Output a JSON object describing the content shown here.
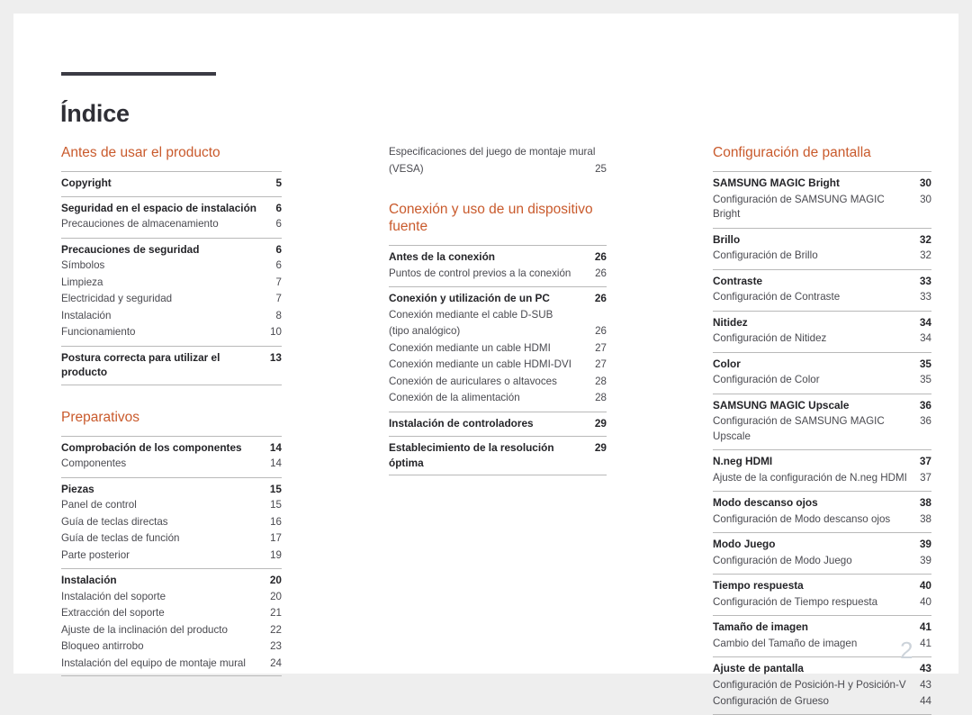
{
  "document": {
    "title": "Índice",
    "folio": "2",
    "accent_color": "#c95a2c",
    "rule_color": "#3b3b44",
    "text_color": "#3a3a40",
    "page_background": "#ffffff",
    "canvas_background": "#eeeeee"
  },
  "columns": [
    {
      "name": "column-left",
      "sections": [
        {
          "heading": "Antes de usar el producto",
          "groups": [
            {
              "entries": [
                {
                  "label": "Copyright",
                  "page": "5",
                  "level": "main"
                }
              ]
            },
            {
              "entries": [
                {
                  "label": "Seguridad en el espacio de instalación",
                  "page": "6",
                  "level": "main"
                },
                {
                  "label": "Precauciones de almacenamiento",
                  "page": "6",
                  "level": "sub"
                }
              ]
            },
            {
              "entries": [
                {
                  "label": "Precauciones de seguridad",
                  "page": "6",
                  "level": "main"
                },
                {
                  "label": "Símbolos",
                  "page": "6",
                  "level": "sub"
                },
                {
                  "label": "Limpieza",
                  "page": "7",
                  "level": "sub"
                },
                {
                  "label": "Electricidad y seguridad",
                  "page": "7",
                  "level": "sub"
                },
                {
                  "label": "Instalación",
                  "page": "8",
                  "level": "sub"
                },
                {
                  "label": "Funcionamiento",
                  "page": "10",
                  "level": "sub"
                }
              ]
            },
            {
              "entries": [
                {
                  "label": "Postura correcta para utilizar el producto",
                  "page": "13",
                  "level": "main"
                }
              ]
            }
          ]
        },
        {
          "heading": "Preparativos",
          "groups": [
            {
              "entries": [
                {
                  "label": "Comprobación de los componentes",
                  "page": "14",
                  "level": "main"
                },
                {
                  "label": "Componentes",
                  "page": "14",
                  "level": "sub"
                }
              ]
            },
            {
              "entries": [
                {
                  "label": "Piezas",
                  "page": "15",
                  "level": "main"
                },
                {
                  "label": "Panel de control",
                  "page": "15",
                  "level": "sub"
                },
                {
                  "label": "Guía de teclas directas",
                  "page": "16",
                  "level": "sub"
                },
                {
                  "label": "Guía de teclas de función",
                  "page": "17",
                  "level": "sub"
                },
                {
                  "label": "Parte posterior",
                  "page": "19",
                  "level": "sub"
                }
              ]
            },
            {
              "entries": [
                {
                  "label": "Instalación",
                  "page": "20",
                  "level": "main"
                },
                {
                  "label": "Instalación del soporte",
                  "page": "20",
                  "level": "sub"
                },
                {
                  "label": "Extracción del soporte",
                  "page": "21",
                  "level": "sub"
                },
                {
                  "label": "Ajuste de la inclinación del producto",
                  "page": "22",
                  "level": "sub"
                },
                {
                  "label": "Bloqueo antirrobo",
                  "page": "23",
                  "level": "sub"
                },
                {
                  "label": "Instalación del equipo de montaje mural",
                  "page": "24",
                  "level": "sub"
                }
              ]
            }
          ]
        }
      ]
    },
    {
      "name": "column-middle",
      "continued": {
        "line1": "Especificaciones del juego de montaje mural",
        "line2": "(VESA)",
        "page": "25"
      },
      "sections": [
        {
          "heading": "Conexión y uso de un dispositivo fuente",
          "groups": [
            {
              "entries": [
                {
                  "label": "Antes de la conexión",
                  "page": "26",
                  "level": "main"
                },
                {
                  "label": "Puntos de control previos a la conexión",
                  "page": "26",
                  "level": "sub"
                }
              ]
            },
            {
              "entries": [
                {
                  "label": "Conexión y utilización de un PC",
                  "page": "26",
                  "level": "main"
                },
                {
                  "label": "Conexión mediante el cable D-SUB",
                  "label2": "(tipo analógico)",
                  "page": "26",
                  "level": "sub"
                },
                {
                  "label": "Conexión mediante un cable HDMI",
                  "page": "27",
                  "level": "sub"
                },
                {
                  "label": "Conexión mediante un cable HDMI-DVI",
                  "page": "27",
                  "level": "sub"
                },
                {
                  "label": "Conexión de auriculares o altavoces",
                  "page": "28",
                  "level": "sub"
                },
                {
                  "label": "Conexión de la alimentación",
                  "page": "28",
                  "level": "sub"
                }
              ]
            },
            {
              "entries": [
                {
                  "label": "Instalación de controladores",
                  "page": "29",
                  "level": "main"
                }
              ]
            },
            {
              "entries": [
                {
                  "label": "Establecimiento de la resolución óptima",
                  "page": "29",
                  "level": "main"
                }
              ]
            }
          ]
        }
      ]
    },
    {
      "name": "column-right",
      "sections": [
        {
          "heading": "Configuración de pantalla",
          "groups": [
            {
              "entries": [
                {
                  "label": "SAMSUNG MAGIC Bright",
                  "page": "30",
                  "level": "main"
                },
                {
                  "label": "Configuración de SAMSUNG MAGIC Bright",
                  "page": "30",
                  "level": "sub"
                }
              ]
            },
            {
              "entries": [
                {
                  "label": "Brillo",
                  "page": "32",
                  "level": "main"
                },
                {
                  "label": "Configuración de Brillo",
                  "page": "32",
                  "level": "sub"
                }
              ]
            },
            {
              "entries": [
                {
                  "label": "Contraste",
                  "page": "33",
                  "level": "main"
                },
                {
                  "label": "Configuración de Contraste",
                  "page": "33",
                  "level": "sub"
                }
              ]
            },
            {
              "entries": [
                {
                  "label": "Nitidez",
                  "page": "34",
                  "level": "main"
                },
                {
                  "label": "Configuración de Nitidez",
                  "page": "34",
                  "level": "sub"
                }
              ]
            },
            {
              "entries": [
                {
                  "label": "Color",
                  "page": "35",
                  "level": "main"
                },
                {
                  "label": "Configuración de Color",
                  "page": "35",
                  "level": "sub"
                }
              ]
            },
            {
              "entries": [
                {
                  "label": "SAMSUNG MAGIC Upscale",
                  "page": "36",
                  "level": "main"
                },
                {
                  "label": "Configuración de SAMSUNG MAGIC Upscale",
                  "page": "36",
                  "level": "sub"
                }
              ]
            },
            {
              "entries": [
                {
                  "label": "N.neg HDMI",
                  "page": "37",
                  "level": "main"
                },
                {
                  "label": "Ajuste de la configuración de N.neg HDMI",
                  "page": "37",
                  "level": "sub"
                }
              ]
            },
            {
              "entries": [
                {
                  "label": "Modo descanso ojos",
                  "page": "38",
                  "level": "main"
                },
                {
                  "label": "Configuración de Modo descanso ojos",
                  "page": "38",
                  "level": "sub"
                }
              ]
            },
            {
              "entries": [
                {
                  "label": "Modo Juego",
                  "page": "39",
                  "level": "main"
                },
                {
                  "label": "Configuración de Modo Juego",
                  "page": "39",
                  "level": "sub"
                }
              ]
            },
            {
              "entries": [
                {
                  "label": "Tiempo respuesta",
                  "page": "40",
                  "level": "main"
                },
                {
                  "label": "Configuración de Tiempo respuesta",
                  "page": "40",
                  "level": "sub"
                }
              ]
            },
            {
              "entries": [
                {
                  "label": "Tamaño de imagen",
                  "page": "41",
                  "level": "main"
                },
                {
                  "label": "Cambio del Tamaño de imagen",
                  "page": "41",
                  "level": "sub"
                }
              ]
            },
            {
              "entries": [
                {
                  "label": "Ajuste de pantalla",
                  "page": "43",
                  "level": "main"
                },
                {
                  "label": "Configuración de Posición-H y Posición-V",
                  "page": "43",
                  "level": "sub"
                },
                {
                  "label": "Configuración de Grueso",
                  "page": "44",
                  "level": "sub"
                }
              ]
            }
          ]
        }
      ]
    }
  ]
}
